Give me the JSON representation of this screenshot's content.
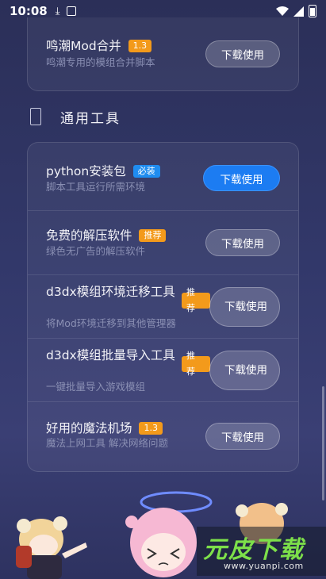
{
  "status_bar": {
    "time": "10:08",
    "icons": [
      "download-icon",
      "app-icon",
      "wifi-icon",
      "signal-icon",
      "battery-icon"
    ]
  },
  "top_card": {
    "item": {
      "title": "鸣潮Mod合并",
      "badge": "1.3",
      "desc": "鸣潮专用的模组合并脚本",
      "button": "下载使用"
    }
  },
  "section": {
    "title": "通用工具",
    "icon": "phone-icon"
  },
  "items": [
    {
      "title": "python安装包",
      "badge": "必装",
      "badge_color": "#1f8cf0",
      "desc": "脚本工具运行所需环境",
      "button": "下载使用",
      "primary": true
    },
    {
      "title": "免费的解压软件",
      "badge": "推荐",
      "badge_color": "#f39a1b",
      "desc": "绿色无广告的解压软件",
      "button": "下载使用"
    },
    {
      "title": "d3dx模组环境迁移工具",
      "badge": "推荐",
      "badge_color": "#f39a1b",
      "desc": "将Mod环境迁移到其他管理器",
      "button": "下载使用"
    },
    {
      "title": "d3dx模组批量导入工具",
      "badge": "推荐",
      "badge_color": "#f39a1b",
      "desc": "一键批量导入游戏模组",
      "button": "下载使用"
    },
    {
      "title": "好用的魔法机场",
      "badge": "1.3",
      "badge_color": "#f39a1b",
      "desc": "魔法上网工具 解决网络问题",
      "button": "下载使用"
    }
  ],
  "watermark": {
    "main": "元皮下载",
    "url": "www.yuanpi.com"
  },
  "colors": {
    "accent": "#1c7cf2",
    "badge_orange": "#f39a1b",
    "badge_blue": "#1f8cf0",
    "watermark_green": "#7de04a"
  }
}
